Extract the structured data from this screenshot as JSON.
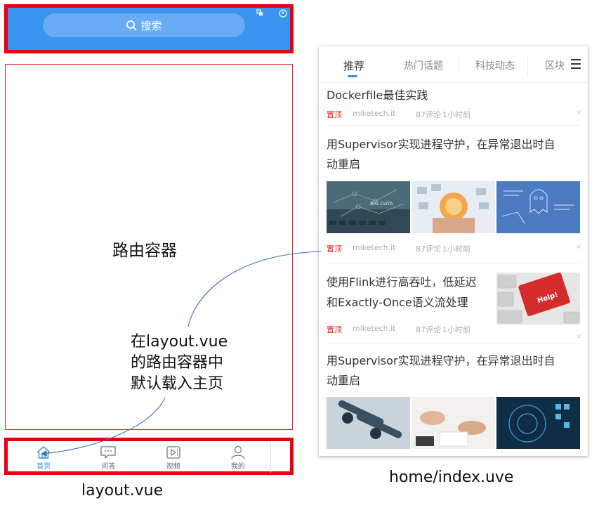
{
  "layout": {
    "header": {
      "search_label": "搜索"
    },
    "router_label": "路由容器",
    "description_lines": [
      "在layout.vue",
      "的路由容器中",
      "默认载入主页"
    ],
    "tabbar": [
      {
        "label": "首页",
        "icon": "home-icon",
        "active": true
      },
      {
        "label": "问答",
        "icon": "chat-bubble-icon",
        "active": false
      },
      {
        "label": "视频",
        "icon": "video-play-icon",
        "active": false
      },
      {
        "label": "我的",
        "icon": "user-icon",
        "active": false
      }
    ],
    "caption": "layout.vue"
  },
  "home": {
    "tabs": [
      "推荐",
      "热门话题",
      "科技动态",
      "区块"
    ],
    "menu_icon": "hamburger-menu-icon",
    "articles": [
      {
        "title_lines": [
          "Dockerfile最佳实践"
        ],
        "tag": "置顶",
        "source": "miketech.it",
        "comments": "87评论",
        "time": "1小时前"
      },
      {
        "title_lines": [
          "用Supervisor实现进程守护，在异常退出时自",
          "动重启"
        ],
        "tag": "置顶",
        "source": "miketech.it",
        "comments": "87评论",
        "time": "1小时前"
      },
      {
        "title_lines": [
          "使用Flink进行高吞吐，低延迟",
          "和Exactly-Once语义流处理"
        ],
        "tag": "置顶",
        "source": "miketech.it",
        "comments": "87评论",
        "time": "1小时前"
      },
      {
        "title_lines": [
          "用Supervisor实现进程守护，在异常退出时自",
          "动重启"
        ]
      }
    ],
    "thumbnail_texts": {
      "big_data": "BIG DATA",
      "help_key": "Help!"
    },
    "caption": "home/index.uve"
  },
  "colors": {
    "frame_red": "#e60012",
    "header_blue": "#3a95f0",
    "accent_blue": "#3a8ee6",
    "tag_red": "#e22222"
  }
}
